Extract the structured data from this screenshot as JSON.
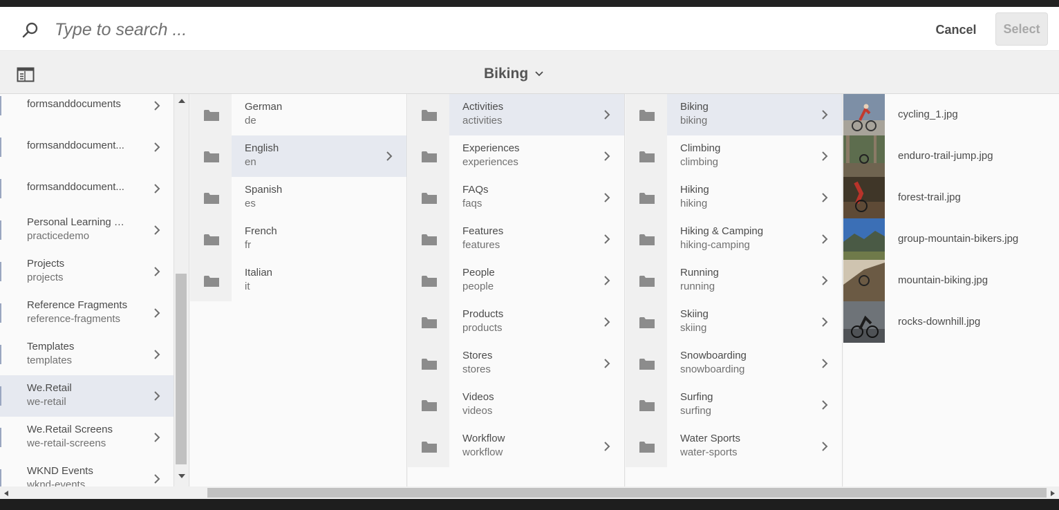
{
  "search": {
    "placeholder": "Type to search ..."
  },
  "actions": {
    "cancel_label": "Cancel",
    "select_label": "Select"
  },
  "toolbar": {
    "title": "Biking"
  },
  "column1": {
    "items": [
      {
        "title": "formsanddocuments",
        "subtitle": ""
      },
      {
        "title": "formsanddocument...",
        "subtitle": ""
      },
      {
        "title": "formsanddocument...",
        "subtitle": ""
      },
      {
        "title": "Personal Learning D...",
        "subtitle": "practicedemo"
      },
      {
        "title": "Projects",
        "subtitle": "projects"
      },
      {
        "title": "Reference Fragments",
        "subtitle": "reference-fragments"
      },
      {
        "title": "Templates",
        "subtitle": "templates"
      },
      {
        "title": "We.Retail",
        "subtitle": "we-retail"
      },
      {
        "title": "We.Retail Screens",
        "subtitle": "we-retail-screens"
      },
      {
        "title": "WKND Events",
        "subtitle": "wknd-events"
      }
    ]
  },
  "column2": {
    "items": [
      {
        "title": "German",
        "subtitle": "de"
      },
      {
        "title": "English",
        "subtitle": "en"
      },
      {
        "title": "Spanish",
        "subtitle": "es"
      },
      {
        "title": "French",
        "subtitle": "fr"
      },
      {
        "title": "Italian",
        "subtitle": "it"
      }
    ]
  },
  "column3": {
    "items": [
      {
        "title": "Activities",
        "subtitle": "activities"
      },
      {
        "title": "Experiences",
        "subtitle": "experiences"
      },
      {
        "title": "FAQs",
        "subtitle": "faqs"
      },
      {
        "title": "Features",
        "subtitle": "features"
      },
      {
        "title": "People",
        "subtitle": "people"
      },
      {
        "title": "Products",
        "subtitle": "products"
      },
      {
        "title": "Stores",
        "subtitle": "stores"
      },
      {
        "title": "Videos",
        "subtitle": "videos"
      },
      {
        "title": "Workflow",
        "subtitle": "workflow"
      }
    ]
  },
  "column4": {
    "items": [
      {
        "title": "Biking",
        "subtitle": "biking"
      },
      {
        "title": "Climbing",
        "subtitle": "climbing"
      },
      {
        "title": "Hiking",
        "subtitle": "hiking"
      },
      {
        "title": "Hiking & Camping",
        "subtitle": "hiking-camping"
      },
      {
        "title": "Running",
        "subtitle": "running"
      },
      {
        "title": "Skiing",
        "subtitle": "skiing"
      },
      {
        "title": "Snowboarding",
        "subtitle": "snowboarding"
      },
      {
        "title": "Surfing",
        "subtitle": "surfing"
      },
      {
        "title": "Water Sports",
        "subtitle": "water-sports"
      }
    ]
  },
  "column5": {
    "items": [
      {
        "title": "cycling_1.jpg"
      },
      {
        "title": "enduro-trail-jump.jpg"
      },
      {
        "title": "forest-trail.jpg"
      },
      {
        "title": "group-mountain-bikers.jpg"
      },
      {
        "title": "mountain-biking.jpg"
      },
      {
        "title": "rocks-downhill.jpg"
      }
    ]
  },
  "colors": {
    "selected_row": "#e6e9f0",
    "folder_icon": "#8c8c8c",
    "text_primary": "#4b4b4b",
    "text_secondary": "#707070"
  }
}
